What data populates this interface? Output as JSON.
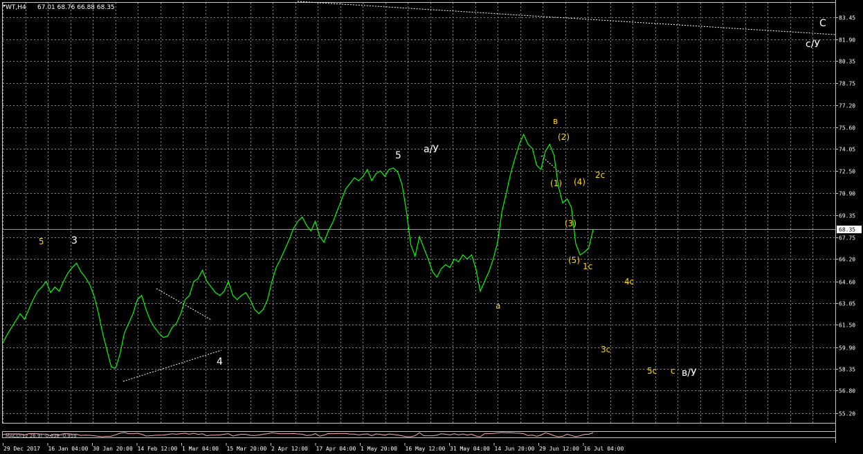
{
  "header": {
    "symbol": "WT,H4",
    "ohlc": "67.01 68.76 66.88 68.35"
  },
  "colors": {
    "background": "#000000",
    "grid": "#8a8a8a",
    "price_line": "#00ff00",
    "axis_text": "#ffffff",
    "wave_white": "#ffffff",
    "wave_yellow": "#ffd700",
    "trendline": "#ffffff",
    "current_price_bg": "#ffffff",
    "indicator_line": "#ffb0b0"
  },
  "chart_data": {
    "type": "line",
    "price_axis": {
      "ylim": [
        54.5,
        84.5
      ],
      "ticks": [
        "83.45",
        "81.90",
        "80.35",
        "78.75",
        "77.20",
        "75.60",
        "74.05",
        "72.50",
        "70.90",
        "69.35",
        "67.75",
        "66.20",
        "64.60",
        "63.05",
        "61.50",
        "59.90",
        "58.35",
        "56.80",
        "55.20"
      ],
      "current_price": "68.35"
    },
    "time_axis": {
      "labels": [
        "29 Dec 2017",
        "16 Jan 04:00",
        "30 Jan 20:00",
        "14 Feb 12:00",
        "1 Mar 04:00",
        "15 Mar 20:00",
        "2 Apr 12:00",
        "17 Apr 04:00",
        "1 May 20:00",
        "16 May 12:00",
        "31 May 04:00",
        "14 Jun 20:00",
        "29 Jun 12:00",
        "16 Jul 04:00"
      ],
      "label_index": [
        0,
        10,
        20,
        30,
        40,
        50,
        60,
        70,
        80,
        90,
        100,
        110,
        120,
        130
      ]
    },
    "series": [
      {
        "values": [
          60.2,
          60.8,
          61.3,
          61.8,
          62.3,
          61.9,
          62.6,
          63.3,
          63.9,
          64.2,
          64.6,
          63.8,
          64.2,
          63.9,
          64.6,
          65.2,
          65.6,
          65.9,
          65.3,
          64.9,
          64.4,
          63.6,
          62.4,
          60.9,
          59.7,
          58.5,
          58.4,
          59.4,
          60.9,
          61.6,
          62.3,
          63.3,
          63.6,
          62.6,
          61.8,
          61.3,
          60.9,
          60.6,
          60.7,
          61.3,
          61.6,
          62.3,
          63.3,
          63.6,
          64.6,
          64.8,
          65.4,
          64.6,
          64.2,
          63.8,
          63.6,
          63.9,
          64.6,
          63.6,
          63.3,
          63.6,
          63.8,
          63.3,
          62.6,
          62.3,
          62.6,
          63.3,
          64.6,
          65.6,
          66.2,
          66.9,
          67.6,
          68.4,
          68.9,
          69.2,
          68.6,
          68.2,
          68.9,
          67.8,
          67.4,
          68.2,
          68.8,
          69.6,
          70.4,
          71.2,
          71.6,
          72.0,
          71.8,
          72.1,
          72.6,
          71.8,
          72.3,
          72.5,
          72.1,
          72.6,
          72.7,
          72.4,
          71.5,
          69.6,
          67.2,
          66.4,
          67.8,
          67.0,
          66.2,
          65.3,
          64.9,
          65.5,
          65.8,
          65.6,
          66.2,
          66.0,
          66.5,
          66.2,
          66.5,
          65.5,
          63.9,
          64.6,
          65.3,
          66.2,
          67.4,
          69.6,
          70.9,
          72.3,
          73.4,
          74.4,
          75.1,
          74.4,
          74.1,
          72.9,
          72.6,
          73.9,
          74.4,
          73.6,
          71.4,
          70.2,
          70.5,
          69.9,
          67.3,
          66.5,
          66.7,
          67.0,
          68.3
        ]
      }
    ]
  },
  "wave_labels": {
    "white": {
      "w3": "3",
      "w4": "4",
      "w5": "5",
      "a_wave": "а/У",
      "c_wave": "С",
      "c_sub": "с/У",
      "b_sub": "в/У"
    },
    "yellow": {
      "y5": "5",
      "a": "а",
      "b": "в",
      "s1": "(1)",
      "s2": "(2)",
      "s3": "(3)",
      "s4": "(4)",
      "s5": "(5)",
      "c1": "1с",
      "c2": "2с",
      "c3": "3с",
      "c4": "4с",
      "c5": "5с",
      "c": "с"
    }
  },
  "indicator": {
    "label": "MACD(12,26,9) -0.638 -0.959"
  }
}
